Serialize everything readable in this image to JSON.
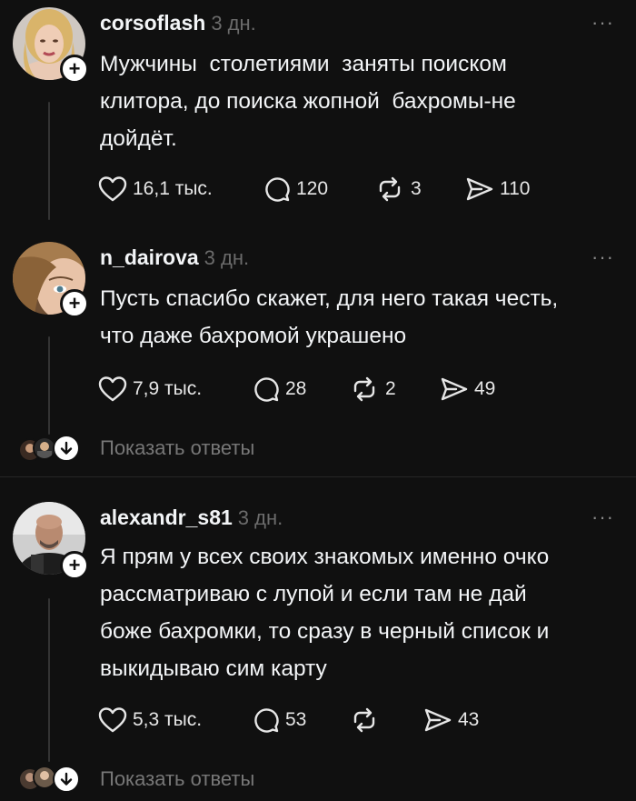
{
  "colors": {
    "background": "#101010",
    "text": "#f3f5f7",
    "muted": "#777777",
    "line": "#333333"
  },
  "posts": [
    {
      "username": "corsoflash",
      "time": "3 дн.",
      "text": "Мужчины  столетиями  заняты поиском\nклитора, до поиска жопной  бахромы-не\nдойдёт.",
      "likes": "16,1 тыс.",
      "comments": "120",
      "reposts": "3",
      "shares": "110",
      "more": "···"
    },
    {
      "username": "n_dairova",
      "time": "3 дн.",
      "text": "Пусть спасибо скажет, для него такая честь,\nчто даже бахромой украшено",
      "likes": "7,9 тыс.",
      "comments": "28",
      "reposts": "2",
      "shares": "49",
      "more": "···"
    },
    {
      "username": "alexandr_s81",
      "time": "3 дн.",
      "text": "Я прям у всех своих знакомых именно очко\nрассматриваю с лупой и если там не дай\nбоже бахромки, то сразу в черный список и\nвыкидываю сим карту",
      "likes": "5,3 тыс.",
      "comments": "53",
      "reposts": "",
      "shares": "43",
      "more": "···"
    }
  ],
  "show_replies_label": "Показать ответы",
  "icons": {
    "like": "heart-icon",
    "comment": "comment-bubble-icon",
    "repost": "repost-arrows-icon",
    "share": "send-arrow-icon",
    "follow": "plus-icon",
    "expand": "arrow-down-icon"
  }
}
